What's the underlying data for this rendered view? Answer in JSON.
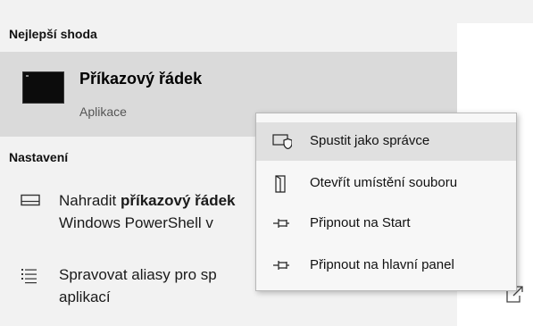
{
  "results": {
    "best_match_header": "Nejlepší shoda",
    "best_match": {
      "icon": "command-prompt-icon",
      "title": "Příkazový řádek",
      "subtitle": "Aplikace"
    },
    "settings_header": "Nastavení",
    "settings": [
      {
        "icon": "monitor-icon",
        "line1_prefix": "Nahradit ",
        "line1_bold": "příkazový řádek",
        "line2": "Windows PowerShell v"
      },
      {
        "icon": "list-icon",
        "line1": "Spravovat aliasy pro sp",
        "line2": "aplikací"
      }
    ],
    "external_link_icon": "open-external-icon"
  },
  "context_menu": {
    "items": [
      {
        "icon": "shield-admin-icon",
        "label": "Spustit jako správce",
        "highlighted": true
      },
      {
        "icon": "open-file-location-icon",
        "label": "Otevřít umístění souboru",
        "highlighted": false
      },
      {
        "icon": "pin-icon",
        "label": "Připnout na Start",
        "highlighted": false
      },
      {
        "icon": "pin-icon",
        "label": "Připnout na hlavní panel",
        "highlighted": false
      }
    ]
  }
}
